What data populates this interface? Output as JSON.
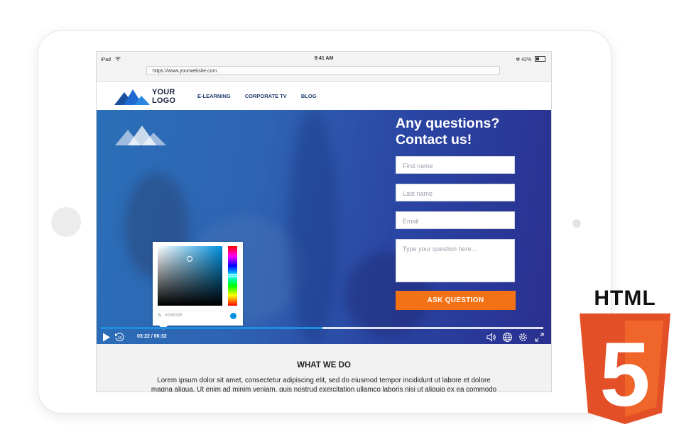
{
  "device": {
    "status_left": "iPad",
    "status_time": "9:41 AM",
    "status_battery": "42%"
  },
  "browser": {
    "url": "https://www.yourwebsite.com"
  },
  "nav": {
    "logo_line1": "YOUR",
    "logo_line2": "LOGO",
    "links": [
      "E-LEARNING",
      "CORPORATE TV",
      "BLOG"
    ]
  },
  "form": {
    "title_line1": "Any questions?",
    "title_line2": "Contact us!",
    "first_name_placeholder": "First name",
    "last_name_placeholder": "Last name",
    "email_placeholder": "Email",
    "question_placeholder": "Type your question here...",
    "submit_label": "ASK QUESTION"
  },
  "color_picker": {
    "hex_value": "#0090DE",
    "selected_color": "#0090de"
  },
  "player": {
    "time": "03:22 / 06:32",
    "progress_fraction": 0.5,
    "rewind_label": "10"
  },
  "section": {
    "title": "WHAT WE DO",
    "line1": "Lorem ipsum dolor sit amet, consectetur adipiscing elit, sed do eiusmod tempor incididunt ut labore et dolore",
    "line2": "magna aliqua. Ut enim ad minim veniam, quis nostrud exercitation ullamco laboris nisi ut aliquip ex ea commodo"
  },
  "badge": {
    "label": "HTML",
    "number": "5",
    "colors": {
      "outer": "#e34f26",
      "inner": "#ef652a"
    }
  },
  "colors": {
    "accent_orange": "#f47216",
    "nav_text": "#1f3c6e",
    "hero_blue": "#2f63b3"
  }
}
